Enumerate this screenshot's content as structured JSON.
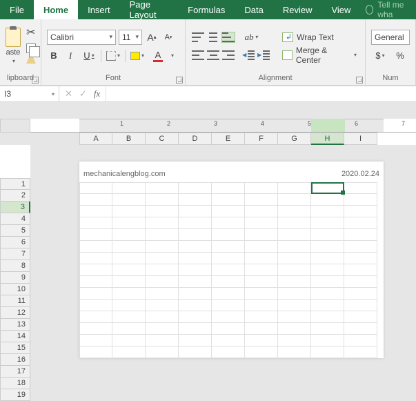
{
  "tabs": {
    "file": "File",
    "home": "Home",
    "insert": "Insert",
    "page_layout": "Page Layout",
    "formulas": "Formulas",
    "data": "Data",
    "review": "Review",
    "view": "View",
    "tell_me": "Tell me wha"
  },
  "ribbon": {
    "clipboard": {
      "label": "lipboard",
      "paste": "aste"
    },
    "font": {
      "label": "Font",
      "name": "Calibri",
      "size": "11",
      "bold": "B",
      "italic": "I",
      "underline": "U",
      "color_letter": "A",
      "grow": "A",
      "shrink": "A"
    },
    "alignment": {
      "label": "Alignment",
      "wrap": "Wrap Text",
      "merge": "Merge & Center"
    },
    "number": {
      "label": "Num",
      "format": "General",
      "currency": "$",
      "percent": "%"
    }
  },
  "formula_bar": {
    "name_box": "I3",
    "cancel": "✕",
    "enter": "✓",
    "fx": "fx"
  },
  "ruler_ticks": [
    "1",
    "2",
    "3",
    "4",
    "5",
    "6",
    "7"
  ],
  "columns": [
    "A",
    "B",
    "C",
    "D",
    "E",
    "F",
    "G",
    "H",
    "I"
  ],
  "rows": [
    "1",
    "2",
    "3",
    "4",
    "5",
    "6",
    "7",
    "8",
    "9",
    "10",
    "11",
    "12",
    "13",
    "14",
    "15",
    "16",
    "17",
    "18",
    "19"
  ],
  "selected_column": "H",
  "selected_row": "3",
  "paper": {
    "header_left": "mechanicalengblog.com",
    "header_right": "2020.02.24"
  },
  "chart_data": null
}
